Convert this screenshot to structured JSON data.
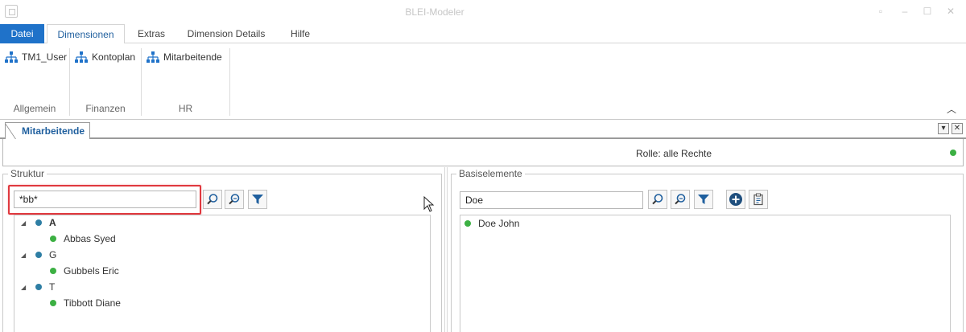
{
  "window": {
    "title": "BLEI-Modeler"
  },
  "ribbon": {
    "tabs": [
      "Datei",
      "Dimensionen",
      "Extras",
      "Dimension Details",
      "Hilfe"
    ],
    "groups": [
      {
        "button": "TM1_User",
        "label": "Allgemein"
      },
      {
        "button": "Kontoplan",
        "label": "Finanzen"
      },
      {
        "button": "Mitarbeitende",
        "label": "HR"
      }
    ]
  },
  "document": {
    "tab": "Mitarbeitende",
    "role": "Rolle: alle Rechte"
  },
  "struktur": {
    "title": "Struktur",
    "search_value": "*bb*",
    "tree": [
      {
        "label": "A",
        "level": 0
      },
      {
        "label": "Abbas Syed",
        "level": 1
      },
      {
        "label": "G",
        "level": 0
      },
      {
        "label": "Gubbels Eric",
        "level": 1
      },
      {
        "label": "T",
        "level": 0
      },
      {
        "label": "Tibbott Diane",
        "level": 1
      }
    ]
  },
  "basiselemente": {
    "title": "Basiselemente",
    "search_value": "Doe",
    "items": [
      "Doe John"
    ]
  },
  "colors": {
    "accent": "#1f72c9",
    "highlight": "#e0383e",
    "status_green": "#3cb043",
    "node_blue": "#2e7ea4"
  },
  "icons": {
    "ribbon_button": "hierarchy-icon",
    "search": "search-icon",
    "search_advanced": "search-advanced-icon",
    "filter": "filter-icon",
    "add": "add-circle-icon",
    "clipboard": "clipboard-icon"
  }
}
